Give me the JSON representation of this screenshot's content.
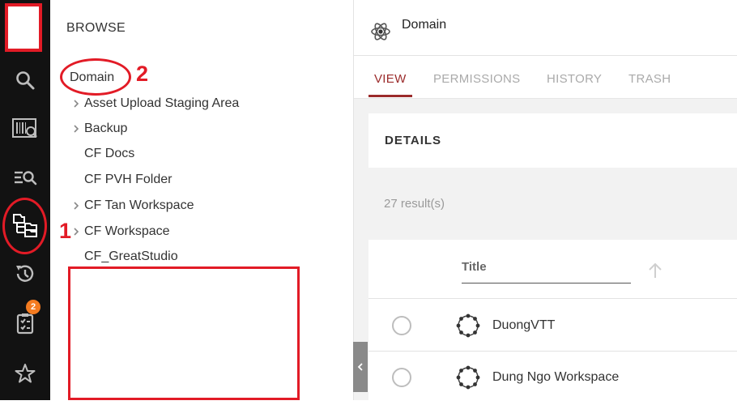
{
  "rail": {
    "items": [
      {
        "icon": "search-icon"
      },
      {
        "icon": "barcode-scan-icon"
      },
      {
        "icon": "list-search-icon"
      },
      {
        "icon": "folder-tree-icon"
      },
      {
        "icon": "history-icon"
      },
      {
        "icon": "tasks-icon",
        "badge": "2"
      },
      {
        "icon": "star-icon"
      }
    ]
  },
  "annotations": {
    "marker_1": "1",
    "marker_2": "2"
  },
  "browse": {
    "title": "BROWSE",
    "root": "Domain",
    "items": [
      {
        "label": "Asset Upload Staging Area",
        "expandable": true
      },
      {
        "label": "Backup",
        "expandable": true
      },
      {
        "label": "CF Docs",
        "expandable": false
      },
      {
        "label": "CF PVH Folder",
        "expandable": false
      },
      {
        "label": "CF Tan Workspace",
        "expandable": true
      },
      {
        "label": "CF Workspace",
        "expandable": true
      },
      {
        "label": "CF_GreatStudio",
        "expandable": false
      }
    ]
  },
  "main": {
    "header_title": "Domain",
    "header_icon": "domain-atom-icon",
    "tabs": [
      "VIEW",
      "PERMISSIONS",
      "HISTORY",
      "TRASH"
    ],
    "active_tab": "VIEW",
    "details_title": "DETAILS",
    "results": "27 result(s)",
    "table": {
      "column_title": "Title",
      "rows": [
        {
          "title": "DuongVTT",
          "icon": "workspace-icon"
        },
        {
          "title": "Dung Ngo Workspace",
          "icon": "workspace-icon"
        }
      ]
    }
  },
  "colors": {
    "accent": "#9b2b2b",
    "annotation": "#e21b26",
    "badge": "#f47b20",
    "rail": "#121212"
  }
}
